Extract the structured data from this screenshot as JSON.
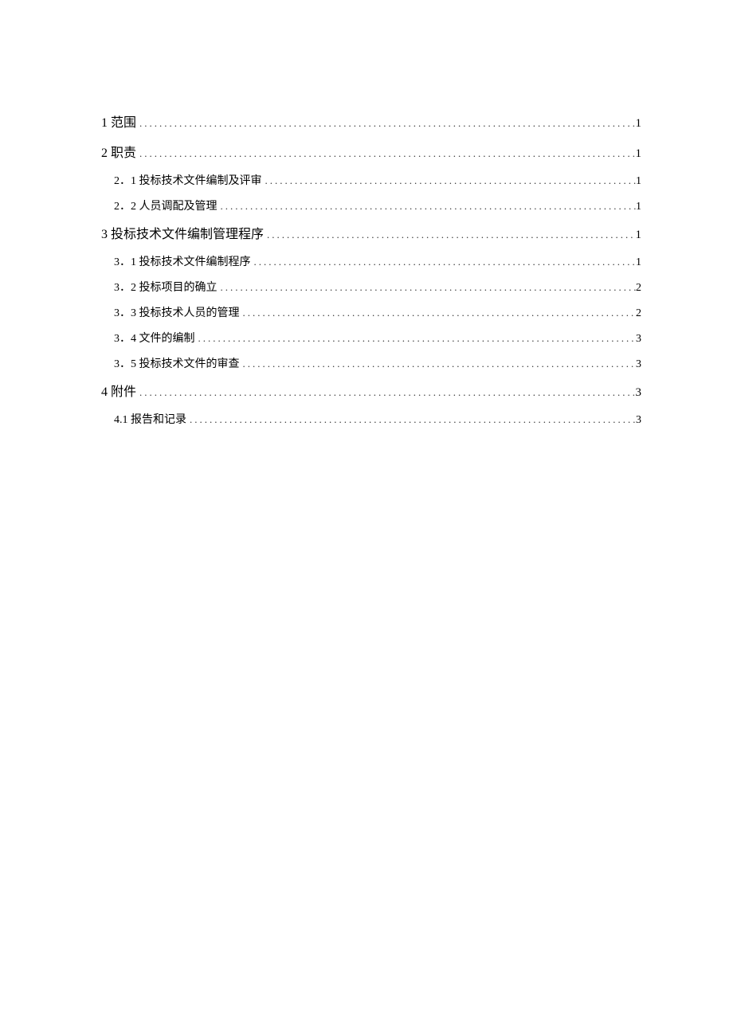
{
  "toc": [
    {
      "level": 1,
      "label": "1 范围",
      "page": "1"
    },
    {
      "level": 1,
      "label": "2 职责",
      "page": "1"
    },
    {
      "level": 2,
      "label": "2．1 投标技术文件编制及评审",
      "page": "1"
    },
    {
      "level": 2,
      "label": "2．2 人员调配及管理",
      "page": "1"
    },
    {
      "level": 1,
      "label": "3 投标技术文件编制管理程序",
      "page": "1"
    },
    {
      "level": 2,
      "label": "3．1 投标技术文件编制程序",
      "page": "1"
    },
    {
      "level": 2,
      "label": "3．2 投标项目的确立",
      "page": "2"
    },
    {
      "level": 2,
      "label": "3．3 投标技术人员的管理",
      "page": "2"
    },
    {
      "level": 2,
      "label": "3．4 文件的编制",
      "page": "3"
    },
    {
      "level": 2,
      "label": "3．5 投标技术文件的审查",
      "page": "3"
    },
    {
      "level": 1,
      "label": "4 附件",
      "page": "3"
    },
    {
      "level": 2,
      "label": "4.1 报告和记录",
      "page": "3"
    }
  ]
}
